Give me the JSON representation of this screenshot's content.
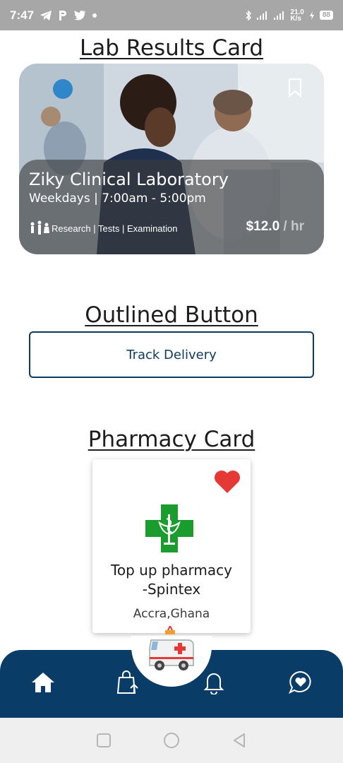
{
  "status_bar": {
    "time": "7:47",
    "icons": [
      "telegram-icon",
      "p-icon",
      "twitter-icon",
      "dot-icon"
    ],
    "right_icons": [
      "bluetooth-icon",
      "signal-icon",
      "signal-icon",
      "charging-icon"
    ],
    "net_speed": "21.0",
    "net_unit": "K/s",
    "battery": "88"
  },
  "lab_section": {
    "title": "Lab Results Card",
    "card": {
      "name": "Ziky Clinical Laboratory",
      "hours": "Weekdays | 7:00am - 5:00pm",
      "tags": "Research | Tests | Examination",
      "price": "$12.0",
      "unit": " / hr",
      "bookmark_icon": "bookmark-icon"
    }
  },
  "outlined_section": {
    "title": "Outlined Button",
    "button_label": "Track Delivery"
  },
  "pharmacy_section": {
    "title": "Pharmacy Card",
    "card": {
      "name_line1": "Top up pharmacy",
      "name_line2": "-Spintex",
      "location": "Accra,Ghana",
      "favorite_icon": "heart-icon",
      "logo_icon": "pharmacy-cross-icon"
    }
  },
  "bottom_nav": {
    "items": [
      "home-icon",
      "upload-bag-icon",
      "bell-icon",
      "chat-heart-icon"
    ],
    "center": "ambulance-icon"
  },
  "system_nav": [
    "square-icon",
    "circle-icon",
    "back-triangle-icon"
  ],
  "colors": {
    "primary": "#093c66",
    "heart": "#e53935",
    "cross": "#1a9c2e"
  }
}
